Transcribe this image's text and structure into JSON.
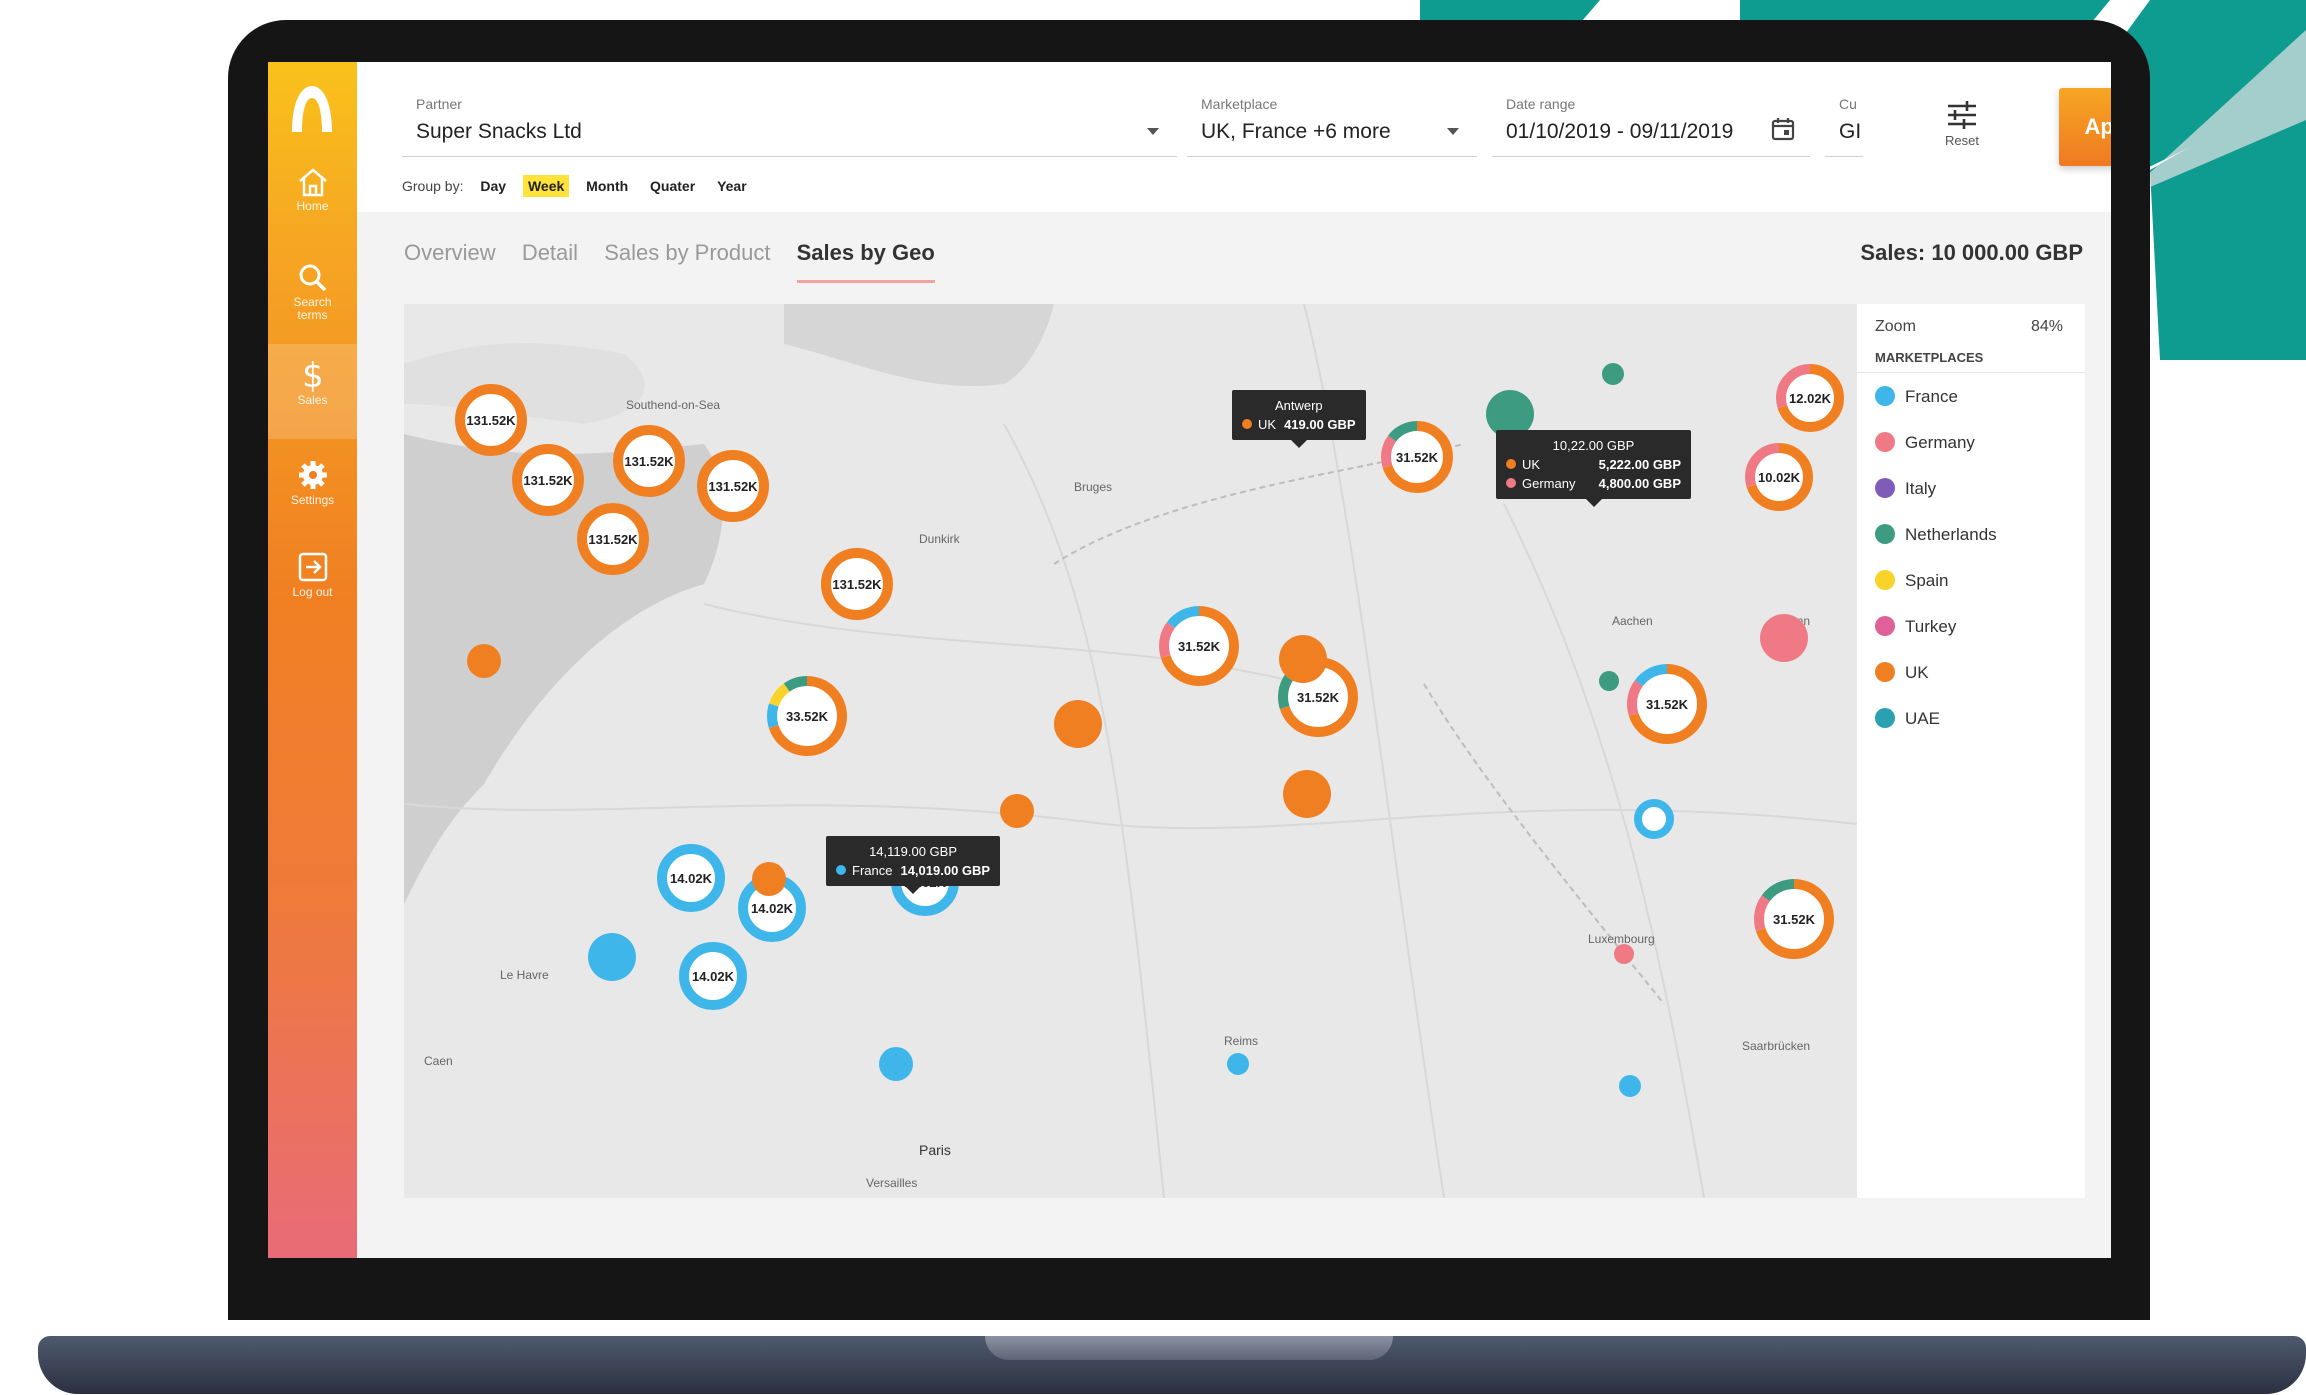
{
  "colors": {
    "france": "#3fb6ea",
    "germany": "#ef7a85",
    "italy": "#7d5db8",
    "netherlands": "#3c9b80",
    "spain": "#f8d32a",
    "turkey": "#e0609a",
    "uk": "#f07f22",
    "uae": "#2aa0b0"
  },
  "sidebar": {
    "items": [
      {
        "label": "Home",
        "icon": "home-icon"
      },
      {
        "label": "Search terms",
        "icon": "search-icon"
      },
      {
        "label": "Sales",
        "icon": "dollar-icon"
      },
      {
        "label": "Settings",
        "icon": "gear-icon"
      },
      {
        "label": "Log out",
        "icon": "logout-icon"
      }
    ]
  },
  "filters": {
    "partner": {
      "label": "Partner",
      "value": "Super Snacks Ltd"
    },
    "marketplace": {
      "label": "Marketplace",
      "value": "UK, France +6 more"
    },
    "date_range": {
      "label": "Date range",
      "value": "01/10/2019 - 09/11/2019"
    },
    "currency": {
      "label": "Cu",
      "value": "GI"
    },
    "reset_label": "Reset",
    "apply_label": "Apply"
  },
  "group_by": {
    "label": "Group by:",
    "options": [
      "Day",
      "Week",
      "Month",
      "Quater",
      "Year"
    ],
    "selected": "Week"
  },
  "tabs": [
    "Overview",
    "Detail",
    "Sales by Product",
    "Sales by Geo"
  ],
  "active_tab": "Sales by Geo",
  "sales_total": "Sales: 10 000.00 GBP",
  "legend": {
    "zoom_label": "Zoom",
    "zoom_value": "84%",
    "title": "MARKETPLACES",
    "items": [
      "France",
      "Germany",
      "Italy",
      "Netherlands",
      "Spain",
      "Turkey",
      "UK",
      "UAE"
    ]
  },
  "map": {
    "place_labels": [
      "Southend-on-Sea",
      "Bruges",
      "Dunkirk",
      "Antwerp",
      "Aachen",
      "Bonn",
      "Luxembourg",
      "Le Havre",
      "Caen",
      "Reims",
      "Paris",
      "Versailles",
      "Saarbrücken"
    ],
    "bubbles": [
      {
        "label": "131.52K"
      },
      {
        "label": "131.52K"
      },
      {
        "label": "131.52K"
      },
      {
        "label": "131.52K"
      },
      {
        "label": "131.52K"
      },
      {
        "label": "131.52K"
      },
      {
        "label": "33.52K"
      },
      {
        "label": "31.52K"
      },
      {
        "label": "31.52K"
      },
      {
        "label": "31.52K"
      },
      {
        "label": "31.52K"
      },
      {
        "label": "31.52K"
      },
      {
        "label": "14.02K"
      },
      {
        "label": "14.02K"
      },
      {
        "label": "14.02K"
      },
      {
        "label": "14.02K"
      },
      {
        "label": "12.02K"
      },
      {
        "label": "10.02K"
      }
    ],
    "tooltips": {
      "antwerp": {
        "title": "Antwerp",
        "rows": [
          {
            "name": "UK",
            "value": "419.00 GBP"
          }
        ]
      },
      "germany": {
        "title": "10,22.00 GBP",
        "rows": [
          {
            "name": "UK",
            "value": "5,222.00 GBP"
          },
          {
            "name": "Germany",
            "value": "4,800.00 GBP"
          }
        ]
      },
      "france": {
        "title": "14,119.00 GBP",
        "rows": [
          {
            "name": "France",
            "value": "14,019.00 GBP"
          }
        ]
      }
    }
  }
}
